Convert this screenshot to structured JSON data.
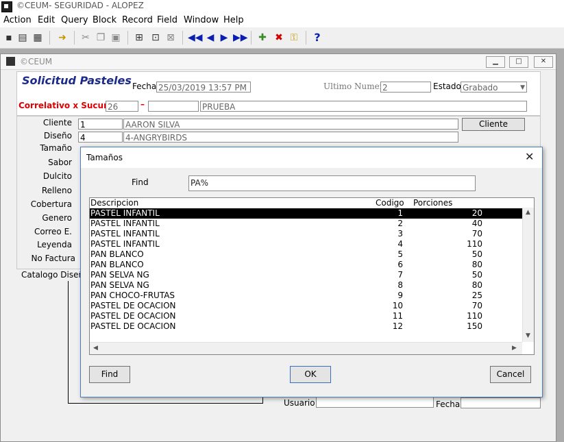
{
  "app": {
    "title": "©CEUM- SEGURIDAD - ALOPEZ"
  },
  "menu": [
    "Action",
    "Edit",
    "Query",
    "Block",
    "Record",
    "Field",
    "Window",
    "Help"
  ],
  "toolbar": {
    "icons": [
      "save-icon",
      "print-icon",
      "print-preview-icon",
      "exit-icon",
      "cut-icon",
      "copy-icon",
      "paste-icon",
      "query-enter-icon",
      "query-execute-icon",
      "query-cancel-icon",
      "first-record-icon",
      "previous-record-icon",
      "next-record-icon",
      "last-record-icon",
      "insert-record-icon",
      "delete-record-icon",
      "lock-record-icon"
    ],
    "help_label": "?"
  },
  "mdi": {
    "title": "©CEUM"
  },
  "form": {
    "heading": "Solicitud Pasteles",
    "fecha_label": "Fecha",
    "fecha_value": "25/03/2019 13:57 PM",
    "ultimo_label": "Ultimo Numero",
    "ultimo_value": "2",
    "estado_label": "Estado",
    "estado_value": "Grabado",
    "correlativo_label": "Correlativo x Sucursal",
    "correlativo_value": "26",
    "dash": "–",
    "correlativo_extra": "",
    "correlativo_name": "PRUEBA",
    "cliente_label": "Cliente",
    "cliente_code": "1",
    "cliente_name": "AARON SILVA",
    "cliente_button": "Cliente",
    "diseno_label": "Diseño",
    "diseno_code": "4",
    "diseno_name": "4-ANGRYBIRDS",
    "side_labels": [
      "Tamaño",
      "Sabor",
      "Dulcito",
      "Relleno",
      "Cobertura",
      "Genero",
      "Correo E.",
      "Leyenda",
      "No Factura"
    ],
    "catalogo_label": "Catalogo Diseño",
    "usuario_label": "Usuario",
    "usuario_value": "",
    "fecha2_label": "Fecha",
    "fecha2_value": ""
  },
  "dialog": {
    "title": "Tamaños",
    "find_label": "Find",
    "find_value": "PA%",
    "columns": [
      "Descripcion",
      "Codigo",
      "Porciones"
    ],
    "rows": [
      {
        "descripcion": "PASTEL INFANTIL",
        "codigo": "1",
        "porciones": "20"
      },
      {
        "descripcion": "PASTEL INFANTIL",
        "codigo": "2",
        "porciones": "40"
      },
      {
        "descripcion": "PASTEL INFANTIL",
        "codigo": "3",
        "porciones": "70"
      },
      {
        "descripcion": "PASTEL INFANTIL",
        "codigo": "4",
        "porciones": "110"
      },
      {
        "descripcion": "PAN BLANCO",
        "codigo": "5",
        "porciones": "50"
      },
      {
        "descripcion": "PAN BLANCO",
        "codigo": "6",
        "porciones": "80"
      },
      {
        "descripcion": "PAN SELVA NG",
        "codigo": "7",
        "porciones": "50"
      },
      {
        "descripcion": "PAN SELVA NG",
        "codigo": "8",
        "porciones": "80"
      },
      {
        "descripcion": "PAN CHOCO-FRUTAS",
        "codigo": "9",
        "porciones": "25"
      },
      {
        "descripcion": "PASTEL DE OCACION",
        "codigo": "10",
        "porciones": "70"
      },
      {
        "descripcion": "PASTEL DE OCACION",
        "codigo": "11",
        "porciones": "110"
      },
      {
        "descripcion": "PASTEL DE OCACION",
        "codigo": "12",
        "porciones": "150"
      }
    ],
    "selected_index": 0,
    "find_button": "Find",
    "ok_button": "OK",
    "cancel_button": "Cancel",
    "close_glyph": "✕"
  },
  "colors": {
    "heading": "#1c2b8a",
    "correlativo_label": "#e00000",
    "selection": "#000000"
  }
}
